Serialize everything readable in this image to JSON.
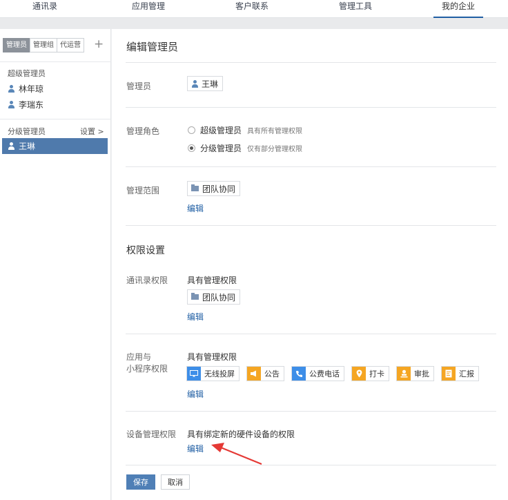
{
  "topnav": {
    "tabs": [
      {
        "label": "通讯录"
      },
      {
        "label": "应用管理"
      },
      {
        "label": "客户联系"
      },
      {
        "label": "管理工具"
      },
      {
        "label": "我的企业"
      }
    ],
    "active": 4
  },
  "sidebar": {
    "tabs": [
      {
        "label": "管理员"
      },
      {
        "label": "管理组"
      },
      {
        "label": "代运营"
      }
    ],
    "add_icon": "plus-icon",
    "super_admin_title": "超级管理员",
    "super_admins": [
      "林年琼",
      "李瑞东"
    ],
    "sub_admin_title": "分级管理员",
    "settings_label": "设置 >",
    "sub_admins": [
      "王琳"
    ]
  },
  "editor": {
    "title": "编辑管理员",
    "admin_label": "管理员",
    "admin_value": "王琳",
    "role_label": "管理角色",
    "roles": [
      {
        "label": "超级管理员",
        "desc": "具有所有管理权限",
        "checked": false
      },
      {
        "label": "分级管理员",
        "desc": "仅有部分管理权限",
        "checked": true
      }
    ],
    "scope_label": "管理范围",
    "scope_value": "团队协同",
    "edit_link": "编辑"
  },
  "permissions": {
    "title": "权限设置",
    "contacts_label": "通讯录权限",
    "contacts_text": "具有管理权限",
    "contacts_scope": "团队协同",
    "contacts_edit": "编辑",
    "apps_label_1": "应用与",
    "apps_label_2": "小程序权限",
    "apps_text": "具有管理权限",
    "apps": [
      {
        "label": "无线投屏",
        "icon": "screencast-icon",
        "color": "#3d8ee8"
      },
      {
        "label": "公告",
        "icon": "megaphone-icon",
        "color": "#f5a623"
      },
      {
        "label": "公费电话",
        "icon": "phone-icon",
        "color": "#3d8ee8"
      },
      {
        "label": "打卡",
        "icon": "location-pin-icon",
        "color": "#f5a623"
      },
      {
        "label": "审批",
        "icon": "person-stamp-icon",
        "color": "#f5a623"
      },
      {
        "label": "汇报",
        "icon": "report-icon",
        "color": "#f5a623"
      }
    ],
    "apps_edit": "编辑",
    "device_label": "设备管理权限",
    "device_text": "具有绑定新的硬件设备的权限",
    "device_edit": "编辑"
  },
  "actions": {
    "save": "保存",
    "cancel": "取消"
  },
  "colors": {
    "accent": "#1f5ea3",
    "selected_bg": "#4f7aac",
    "primary_button": "#4f7fb6",
    "annotation_arrow": "#e53935"
  }
}
